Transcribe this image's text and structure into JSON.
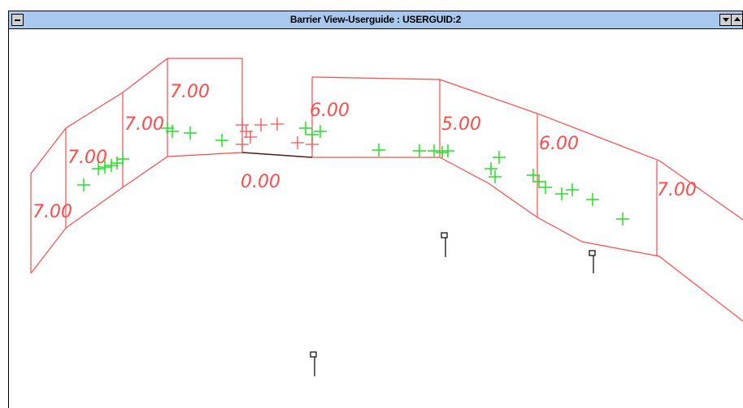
{
  "window": {
    "title": "Barrier View-Userguide : USERGUID:2"
  },
  "colors": {
    "barrier": "#ff4a4a",
    "receiver": "#22e022",
    "marker": "#000000",
    "titlebar": "#a8c8f0"
  },
  "barrier_labels": [
    "7.00",
    "7.00",
    "7.00",
    "7.00",
    "0.00",
    "6.00",
    "5.00",
    "6.00",
    "7.00"
  ],
  "icons": {
    "system_menu": "minus-icon",
    "minimize": "down-arrow-icon",
    "maximize": "up-arrow-icon",
    "marker": "pin-marker-icon"
  }
}
